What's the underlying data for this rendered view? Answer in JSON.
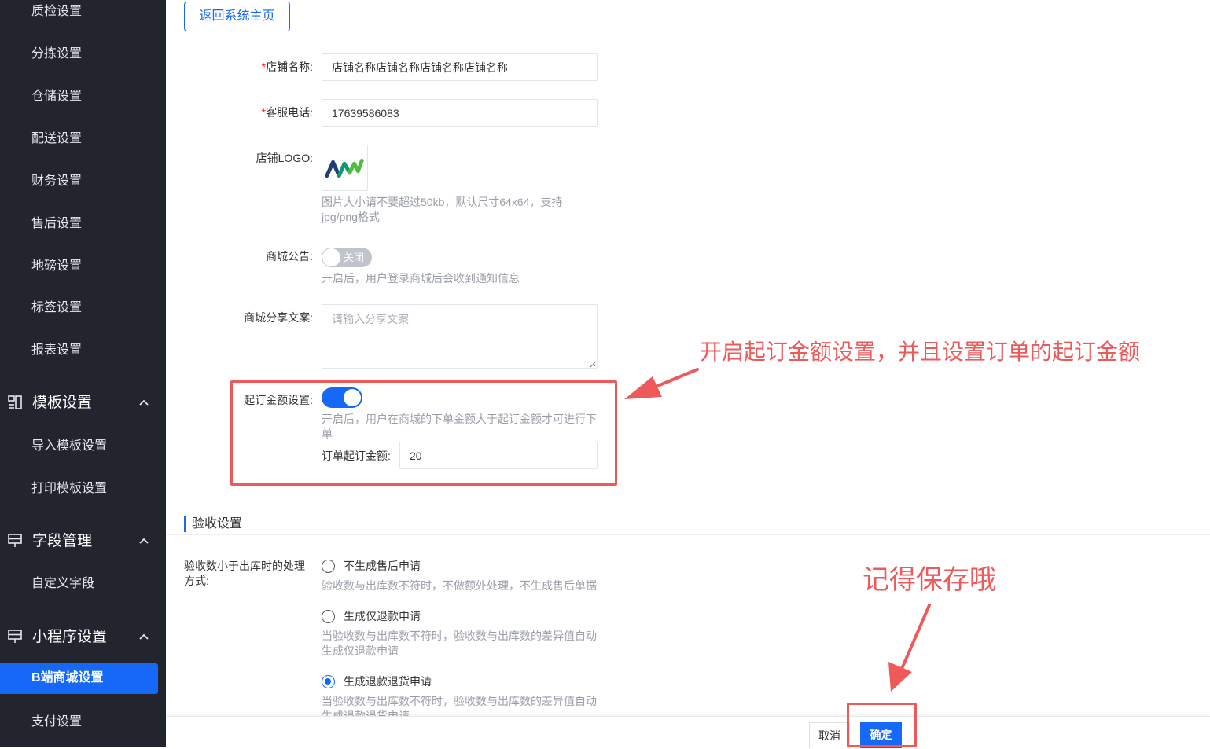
{
  "sidebar": {
    "items_top": [
      "质检设置",
      "分拣设置",
      "仓储设置",
      "配送设置",
      "财务设置",
      "售后设置",
      "地磅设置",
      "标签设置",
      "报表设置"
    ],
    "groups": [
      {
        "label": "模板设置",
        "icon": "template-icon",
        "items": [
          "导入模板设置",
          "打印模板设置"
        ]
      },
      {
        "label": "字段管理",
        "icon": "field-icon",
        "items": [
          "自定义字段"
        ]
      },
      {
        "label": "小程序设置",
        "icon": "mini-program-icon",
        "items": [
          "B端商城设置",
          "支付设置"
        ]
      }
    ],
    "active_item": "B端商城设置"
  },
  "header": {
    "back_button": "返回系统主页"
  },
  "form": {
    "shop_name": {
      "label": "店铺名称:",
      "value": "店铺名称店铺名称店铺名称店铺名称"
    },
    "service_phone": {
      "label": "客服电话:",
      "value": "17639586083"
    },
    "shop_logo": {
      "label": "店铺LOGO:",
      "hint": "图片大小请不要超过50kb，默认尺寸64x64，支持jpg/png格式"
    },
    "announcement": {
      "label": "商城公告:",
      "switch_state": "off",
      "switch_text": "关闭",
      "hint": "开启后，用户登录商城后会收到通知信息"
    },
    "share_text": {
      "label": "商城分享文案:",
      "placeholder": "请输入分享文案",
      "value": ""
    },
    "min_order": {
      "label": "起订金额设置:",
      "switch_state": "on",
      "hint": "开启后，用户在商城的下单金额大于起订金额才可进行下单",
      "amount_label": "订单起订金额:",
      "amount_value": "20"
    }
  },
  "acceptance": {
    "section_title": "验收设置",
    "question_label": "验收数小于出库时的处理方式:",
    "options": [
      {
        "label": "不生成售后申请",
        "hint": "验收数与出库数不符时，不做额外处理，不生成售后单据",
        "checked": false
      },
      {
        "label": "生成仅退款申请",
        "hint": "当验收数与出库数不符时，验收数与出库数的差异值自动生成仅退款申请",
        "checked": false
      },
      {
        "label": "生成退款退货申请",
        "hint": "当验收数与出库数不符时，验收数与出库数的差异值自动生成退款退货申请",
        "checked": true
      }
    ]
  },
  "footer": {
    "cancel": "取消",
    "confirm": "确定"
  },
  "annotations": {
    "note_min_order": "开启起订金额设置，并且设置订单的起订金额",
    "note_save": "记得保存哦",
    "color": "#ee5a5a"
  },
  "colors": {
    "accent": "#1668f6",
    "sidebar_bg": "#22242e",
    "annotation": "#ee5a5a"
  }
}
